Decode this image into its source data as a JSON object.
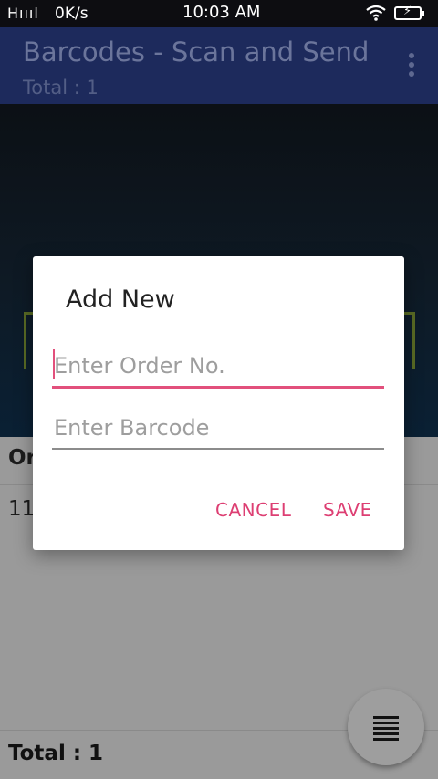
{
  "status_bar": {
    "signal": "Hıııl",
    "network_speed": "0K/s",
    "time": "10:03 AM",
    "wifi_icon": "wifi-icon",
    "battery_icon": "battery-charging-icon"
  },
  "app_bar": {
    "title": "Barcodes - Scan and Send",
    "subtitle": "Total : 1",
    "menu_icon": "more-vert-icon"
  },
  "list": {
    "header_text": "Or",
    "first_row_text": "11"
  },
  "footer": {
    "total": "Total : 1"
  },
  "fab": {
    "icon": "list-icon"
  },
  "dialog": {
    "title": "Add New",
    "order_field": {
      "placeholder": "Enter Order No.",
      "value": ""
    },
    "barcode_field": {
      "placeholder": "Enter Barcode",
      "value": ""
    },
    "cancel_label": "CANCEL",
    "save_label": "SAVE"
  },
  "colors": {
    "app_bar": "#1d2a5c",
    "accent": "#e2507c",
    "button_text": "#dd3f73"
  }
}
